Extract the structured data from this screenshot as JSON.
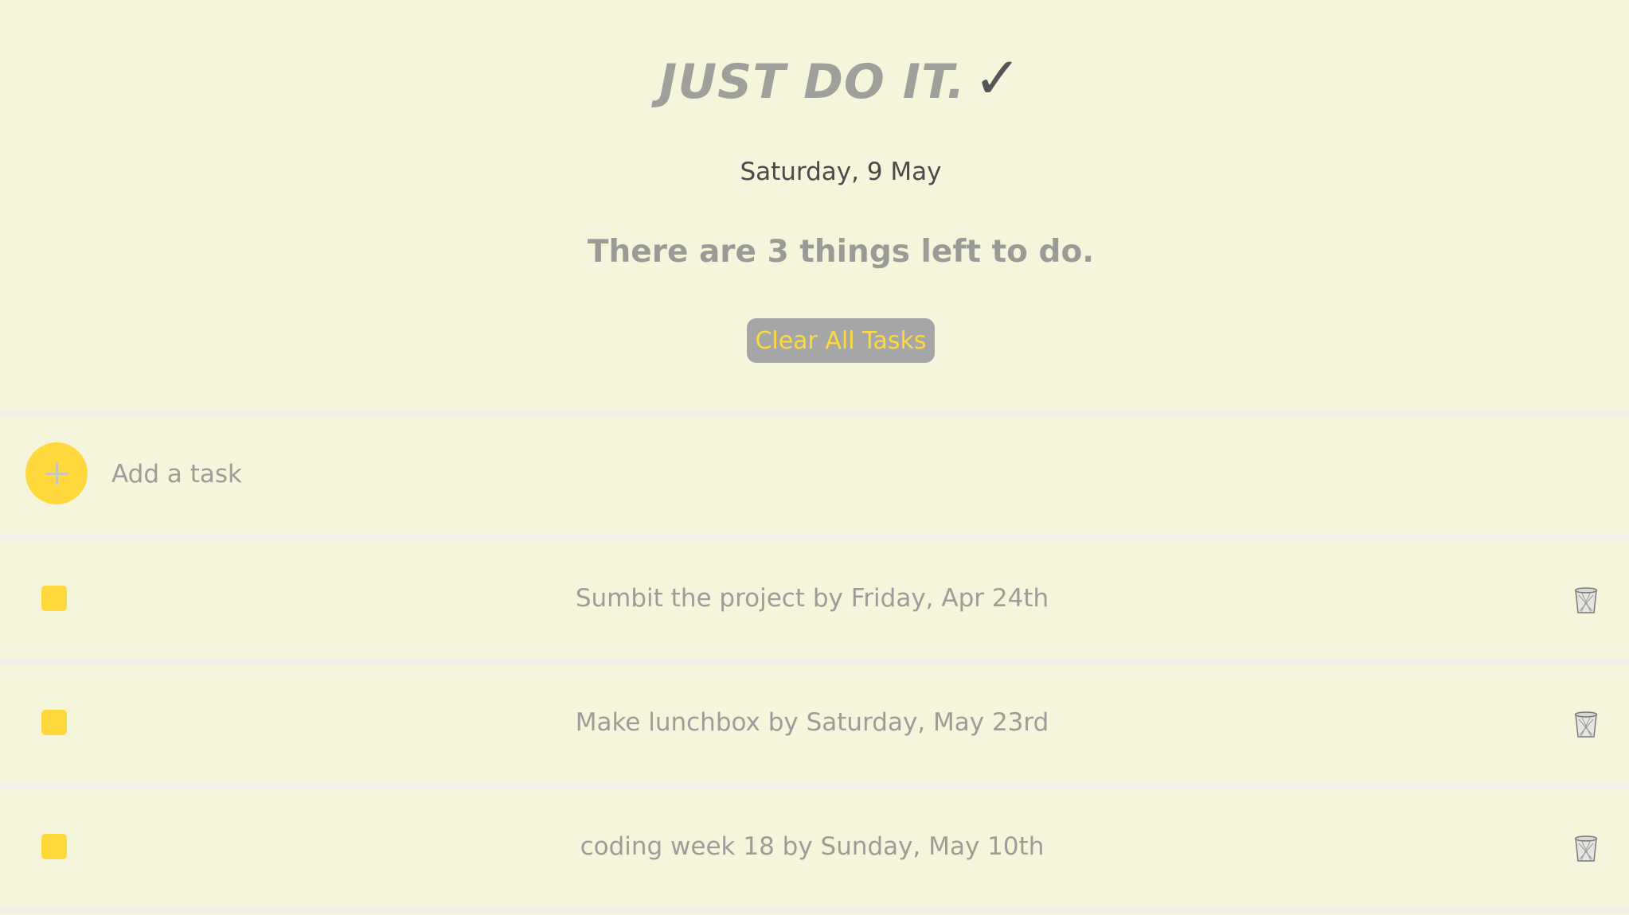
{
  "header": {
    "title": "JUST DO IT.",
    "title_check": "✓",
    "date": "Saturday, 9 May",
    "remaining": "There are 3 things left to do.",
    "clear_label": "Clear All Tasks"
  },
  "add_task": {
    "placeholder": "Add a task",
    "value": ""
  },
  "tasks": [
    {
      "text": "Sumbit the project by Friday, Apr 24th",
      "done": false
    },
    {
      "text": "Make lunchbox by Saturday, May 23rd",
      "done": false
    },
    {
      "text": "coding week 18 by Sunday, May 10th",
      "done": false
    }
  ],
  "colors": {
    "background": "#f5f5dc",
    "accent": "#ffd93b",
    "button_bg": "#a6a6a6",
    "text_muted": "#9d9d97"
  },
  "icons": {
    "add": "plus-icon",
    "delete": "trash-icon",
    "task_check": "checkbox-icon"
  }
}
